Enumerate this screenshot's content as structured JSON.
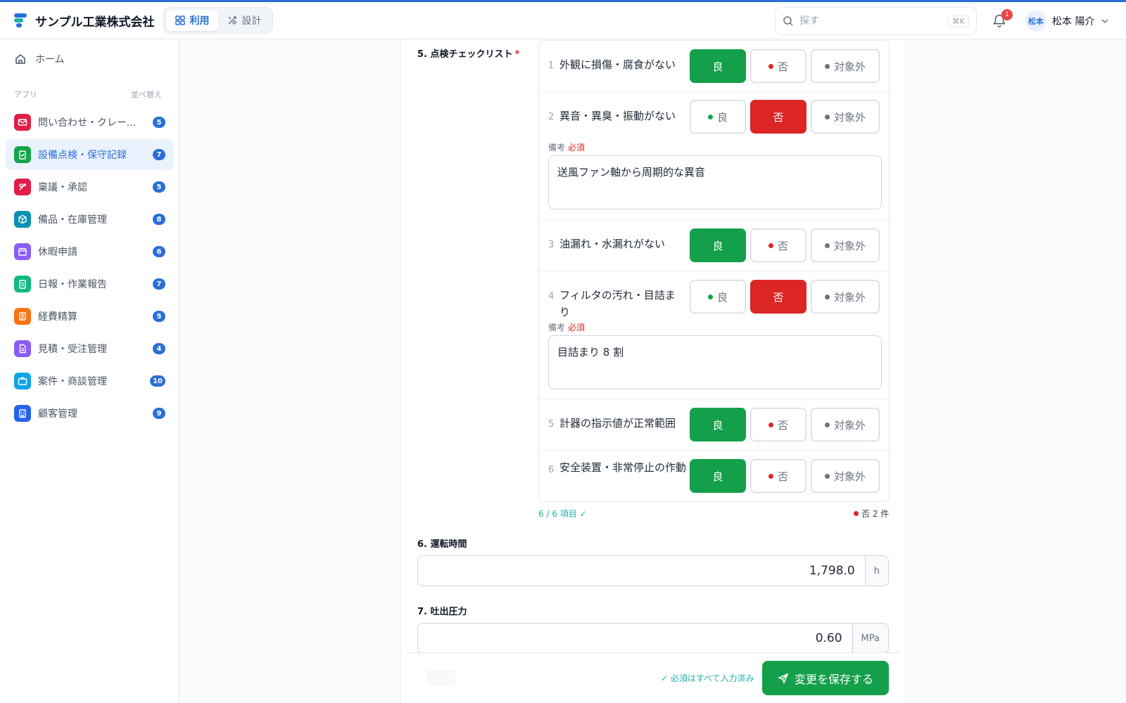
{
  "header": {
    "company": "サンプル工業株式会社",
    "modes": [
      {
        "label": "利用"
      },
      {
        "label": "設計"
      }
    ],
    "search_placeholder": "探す",
    "shortcut": "⌘K",
    "notification_count": "1",
    "avatar_text": "松本",
    "user_name": "松本 陽介"
  },
  "sidebar": {
    "home": "ホーム",
    "apps_heading": "アプリ",
    "sort_label": "並べ替え",
    "items": [
      {
        "label": "問い合わせ・クレーム管理",
        "count": "5",
        "color": "#e11d48",
        "icon": "mail-icon"
      },
      {
        "label": "設備点検・保守記録",
        "count": "7",
        "color": "#16a34a",
        "icon": "clipboard-check-icon"
      },
      {
        "label": "稟議・承認",
        "count": "5",
        "color": "#e11d48",
        "icon": "stamp-icon"
      },
      {
        "label": "備品・在庫管理",
        "count": "8",
        "color": "#0891b2",
        "icon": "box-icon"
      },
      {
        "label": "休暇申請",
        "count": "6",
        "color": "#8b5cf6",
        "icon": "calendar-icon"
      },
      {
        "label": "日報・作業報告",
        "count": "7",
        "color": "#10b981",
        "icon": "clipboard-icon"
      },
      {
        "label": "経費精算",
        "count": "5",
        "color": "#f97316",
        "icon": "receipt-icon"
      },
      {
        "label": "見積・受注管理",
        "count": "4",
        "color": "#8b5cf6",
        "icon": "document-icon"
      },
      {
        "label": "案件・商談管理",
        "count": "10",
        "color": "#0ea5e9",
        "icon": "briefcase-icon"
      },
      {
        "label": "顧客管理",
        "count": "9",
        "color": "#2563eb",
        "icon": "building-icon"
      }
    ]
  },
  "form": {
    "checklist_label": "5. 点検チェックリスト",
    "required_mark": "*",
    "options": {
      "good": "良",
      "bad": "否",
      "na": "対象外"
    },
    "note_label": "備考",
    "note_required": "必須",
    "items": [
      {
        "no": "1",
        "text": "外観に損傷・腐食がない",
        "state": "good",
        "note": ""
      },
      {
        "no": "2",
        "text": "異音・異臭・振動がない",
        "state": "bad",
        "note": "送風ファン軸から周期的な異音"
      },
      {
        "no": "3",
        "text": "油漏れ・水漏れがない",
        "state": "good",
        "note": ""
      },
      {
        "no": "4",
        "text": "フィルタの汚れ・目詰まり",
        "state": "bad",
        "note": "目詰まり 8 割"
      },
      {
        "no": "5",
        "text": "計器の指示値が正常範囲",
        "state": "good",
        "note": ""
      },
      {
        "no": "6",
        "text": "安全装置・非常停止の作動",
        "state": "good",
        "note": ""
      }
    ],
    "progress": "6 / 6 項目 ✓",
    "ng_summary": "否 2 件",
    "runtime_label": "6. 運転時間",
    "runtime_value": "1,798.0",
    "runtime_unit": "h",
    "pressure_label": "7. 吐出圧力",
    "pressure_value": "0.60",
    "pressure_unit": "MPa"
  },
  "footer": {
    "status": "✓ 必須はすべて入力済み",
    "save_label": "変更を保存する"
  }
}
